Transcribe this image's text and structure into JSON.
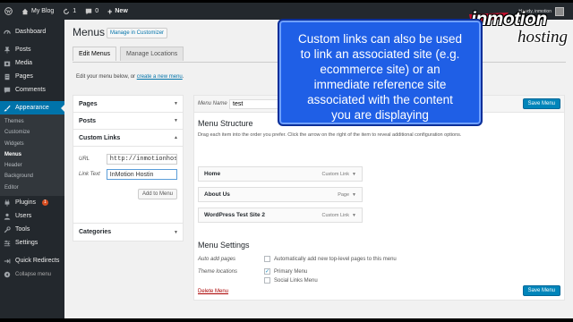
{
  "admin_bar": {
    "site_name": "My Blog",
    "updates_count": "1",
    "comments_count": "0",
    "new_label": "New",
    "howdy": "Howdy, inmotion"
  },
  "sidebar": {
    "items": [
      {
        "label": "Dashboard",
        "icon": "dashboard-icon"
      },
      {
        "label": "Posts",
        "icon": "pin-icon"
      },
      {
        "label": "Media",
        "icon": "media-icon"
      },
      {
        "label": "Pages",
        "icon": "pages-icon"
      },
      {
        "label": "Comments",
        "icon": "comment-icon"
      },
      {
        "label": "Appearance",
        "icon": "brush-icon"
      }
    ],
    "appearance_sub": [
      "Themes",
      "Customize",
      "Widgets",
      "Menus",
      "Header",
      "Background",
      "Editor"
    ],
    "lower_items": [
      {
        "label": "Plugins",
        "icon": "plugin-icon",
        "badge": "1"
      },
      {
        "label": "Users",
        "icon": "users-icon"
      },
      {
        "label": "Tools",
        "icon": "tools-icon"
      },
      {
        "label": "Settings",
        "icon": "settings-icon"
      },
      {
        "label": "Quick Redirects",
        "icon": "redirect-icon"
      },
      {
        "label": "Collapse menu",
        "icon": "collapse-icon"
      }
    ]
  },
  "main": {
    "title": "Menus",
    "manage_customizer": "Manage in Customizer",
    "tabs": [
      "Edit Menus",
      "Manage Locations"
    ],
    "edit_text": "Edit your menu below, or",
    "create_link": "create a new menu",
    "create_suffix": "."
  },
  "accordion": {
    "pages": "Pages",
    "posts": "Posts",
    "custom_links": "Custom Links",
    "url_label": "URL",
    "url_value": "http://inmotionhosti",
    "link_text_label": "Link Text",
    "link_text_value": "InMotion Hostin",
    "add_button": "Add to Menu",
    "categories": "Categories"
  },
  "menu_panel": {
    "menu_name_label": "Menu Name",
    "menu_name_value": "test",
    "save_label": "Save Menu",
    "structure_title": "Menu Structure",
    "drag_text": "Drag each item into the order you prefer. Click the arrow on the right of the item to reveal additional configuration options.",
    "items": [
      {
        "title": "Home",
        "type": "Custom Link"
      },
      {
        "title": "About Us",
        "type": "Page"
      },
      {
        "title": "WordPress Test Site 2",
        "type": "Custom Link"
      }
    ],
    "settings_title": "Menu Settings",
    "auto_add_label": "Auto add pages",
    "auto_add_text": "Automatically add new top-level pages to this menu",
    "theme_locations_label": "Theme locations",
    "primary_menu": "Primary Menu",
    "social_menu": "Social Links Menu",
    "delete_label": "Delete Menu"
  },
  "callout": {
    "lines": [
      "Custom links can also be used",
      "to link an associated site (e.g.",
      "ecommerce site) or an",
      "immediate reference site",
      "associated with the content",
      "you are displaying"
    ]
  },
  "logo": {
    "main": "inmotion",
    "sub": "hosting"
  },
  "colors": {
    "admin_bar": "#23282d",
    "accent": "#0073aa",
    "primary_button": "#0085ba",
    "callout": "#1f5fe6",
    "delete": "#aa0000",
    "badge": "#d54e21"
  }
}
